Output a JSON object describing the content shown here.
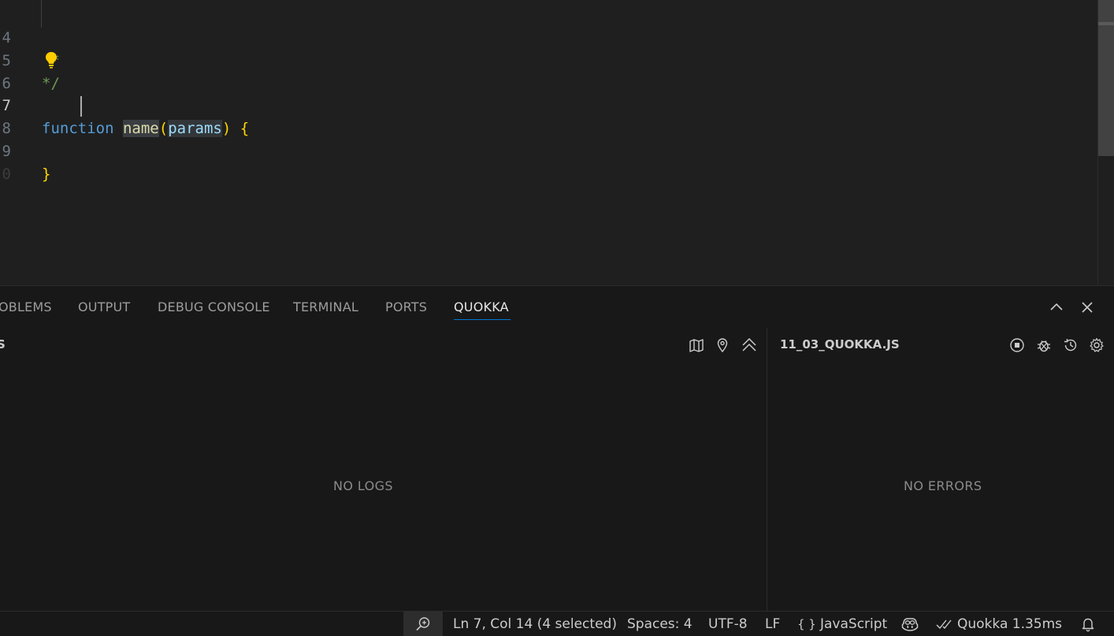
{
  "editor": {
    "lines": [
      {
        "num": "4",
        "text": " *"
      },
      {
        "num": "5",
        "text": "*/"
      },
      {
        "num": "6",
        "text": ""
      },
      {
        "num": "7",
        "keyword": "function",
        "fn_name": "name",
        "open_paren": "(",
        "param": "params",
        "close_paren": ")",
        "brace": "{"
      },
      {
        "num": "8",
        "text": ""
      },
      {
        "num": "9",
        "text": "}"
      },
      {
        "num": "0",
        "text": ""
      }
    ],
    "lightbulb_icon": "lightbulb-icon",
    "colors": {
      "comment": "#6a9955",
      "keyword": "#569cd6",
      "function": "#dcdcaa",
      "parameter": "#9cdcfe",
      "brace": "#ffd700"
    }
  },
  "panel": {
    "tabs": [
      {
        "label": "OBLEMS"
      },
      {
        "label": "OUTPUT"
      },
      {
        "label": "DEBUG CONSOLE"
      },
      {
        "label": "TERMINAL"
      },
      {
        "label": "PORTS"
      },
      {
        "label": "QUOKKA",
        "active": true
      }
    ],
    "accent_color": "#0078d4",
    "actions": [
      "maximize-panel-icon",
      "close-panel-icon"
    ],
    "logs": {
      "title": "S",
      "tools": [
        "map-icon",
        "location-pin-icon",
        "collapse-all-icon"
      ],
      "empty_text": "NO LOGS"
    },
    "errors": {
      "title": "11_03_QUOKKA.JS",
      "tools": [
        "stop-icon",
        "debug-icon",
        "history-icon",
        "settings-icon"
      ],
      "empty_text": "NO ERRORS"
    }
  },
  "statusbar": {
    "zoom_icon": "zoom-in-icon",
    "cursor_position": "Ln 7, Col 14 (4 selected)",
    "indentation": "Spaces: 4",
    "encoding": "UTF-8",
    "line_ending": "LF",
    "language_icon": "{ }",
    "language": "JavaScript",
    "copilot_icon": "copilot-icon",
    "quokka_status": "Quokka 1.35ms",
    "bell_icon": "bell-icon"
  }
}
